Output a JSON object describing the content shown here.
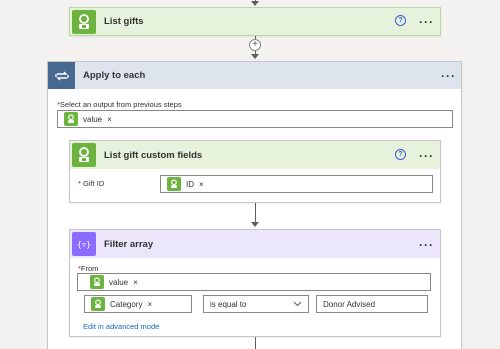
{
  "colors": {
    "accent_green": "#6cb33f",
    "apply_header": "#dee4ed",
    "apply_icon": "#486991",
    "filter_header": "#ece6fa",
    "filter_icon": "#8c6cff",
    "link": "#0f6cbd",
    "required": "#a4262c"
  },
  "list_gifts": {
    "title": "List gifts",
    "help": "?",
    "more": "···"
  },
  "add_step": {
    "symbol": "+"
  },
  "apply_to_each": {
    "title": "Apply to each",
    "more": "···",
    "select_label": "Select an output from previous steps",
    "required_mark": "*",
    "token": {
      "label": "value",
      "remove": "×"
    }
  },
  "list_custom_fields": {
    "title": "List gift custom fields",
    "help": "?",
    "more": "···",
    "gift_id_label": "Gift ID",
    "required_mark": "*",
    "token": {
      "label": "ID",
      "remove": "×"
    }
  },
  "filter_array": {
    "title": "Filter array",
    "icon_glyph": "{▿}",
    "more": "···",
    "from_label": "From",
    "required_mark": "*",
    "from_token": {
      "label": "value",
      "remove": "×"
    },
    "condition": {
      "left_token": {
        "label": "Category",
        "remove": "×"
      },
      "operator": "is equal to",
      "right_value": "Donor Advised"
    },
    "advanced_link": "Edit in advanced mode"
  }
}
